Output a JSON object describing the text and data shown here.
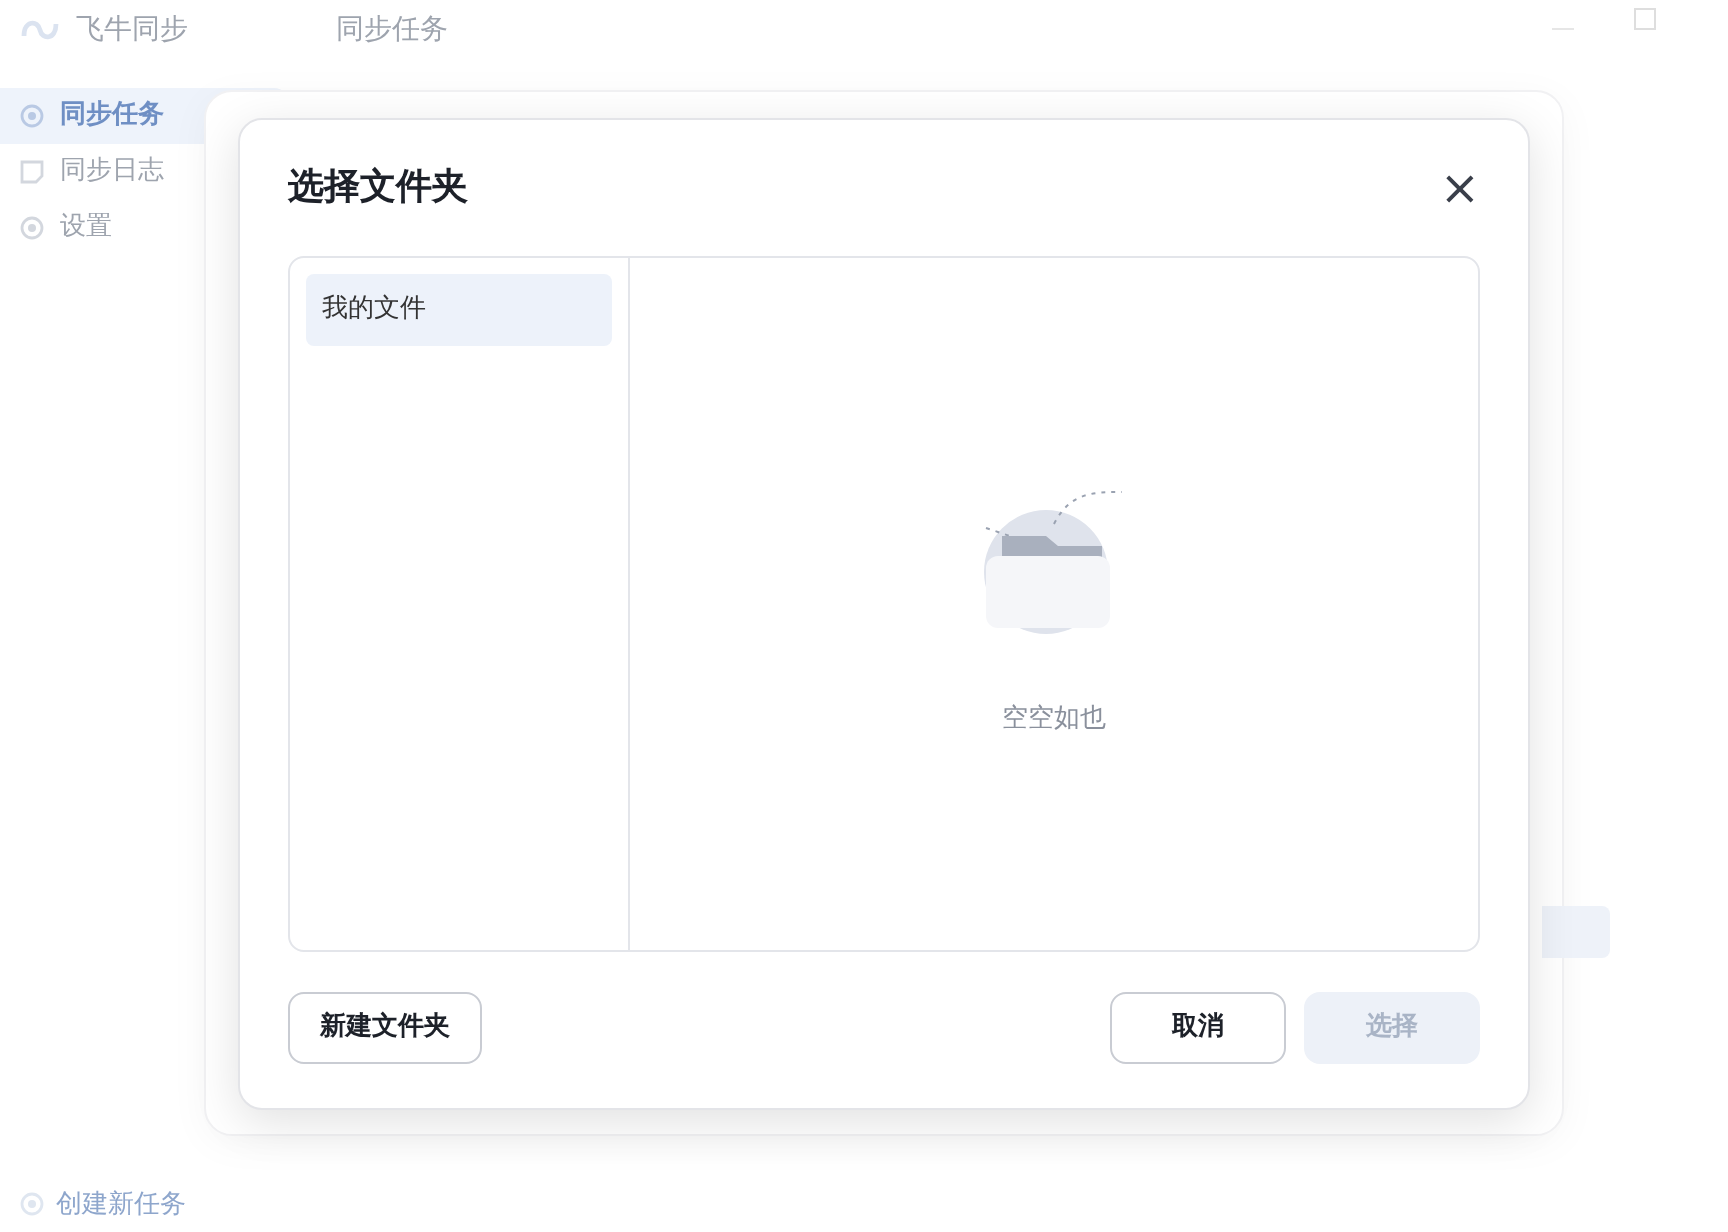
{
  "app": {
    "name": "飞牛同步",
    "page_title": "同步任务"
  },
  "sidebar": {
    "items": [
      {
        "label": "同步任务",
        "selected": true
      },
      {
        "label": "同步日志",
        "selected": false
      },
      {
        "label": "设置",
        "selected": false
      }
    ],
    "footer": "创建新任务"
  },
  "dialog": {
    "title": "选择文件夹",
    "close": "×",
    "tree": [
      {
        "label": "我的文件",
        "selected": true
      }
    ],
    "empty_text": "空空如也",
    "left_buttons": [
      {
        "label": "新建文件夹",
        "kind": "secondary",
        "disabled": false
      }
    ],
    "right_buttons": [
      {
        "label": "取消",
        "kind": "secondary",
        "disabled": false
      },
      {
        "label": "选择",
        "kind": "primary",
        "disabled": true
      }
    ]
  }
}
